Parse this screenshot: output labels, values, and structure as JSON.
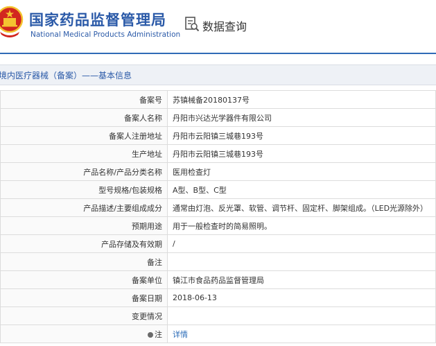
{
  "header": {
    "org_cn": "国家药品监督管理局",
    "org_en": "National Medical Products Administration",
    "query_title": "数据查询"
  },
  "section": {
    "title": "境内医疗器械（备案）——基本信息"
  },
  "rows": [
    {
      "label": "备案号",
      "value": "苏镇械备20180137号"
    },
    {
      "label": "备案人名称",
      "value": "丹阳市兴达光学器件有限公司"
    },
    {
      "label": "备案人注册地址",
      "value": "丹阳市云阳镇三城巷193号"
    },
    {
      "label": "生产地址",
      "value": "丹阳市云阳镇三城巷193号"
    },
    {
      "label": "产品名称/产品分类名称",
      "value": "医用检查灯"
    },
    {
      "label": "型号规格/包装规格",
      "value": "A型、B型、C型"
    },
    {
      "label": "产品描述/主要组成成分",
      "value": "通常由灯泡、反光罩、软管、调节杆、固定杆、脚架组成。（LED光源除外）"
    },
    {
      "label": "预期用途",
      "value": "用于一般检查时的简易照明。"
    },
    {
      "label": "产品存储及有效期",
      "value": "/"
    },
    {
      "label": "备注",
      "value": ""
    },
    {
      "label": "备案单位",
      "value": "镇江市食品药品监督管理局"
    },
    {
      "label": "备案日期",
      "value": "2018-06-13"
    },
    {
      "label": "变更情况",
      "value": ""
    }
  ],
  "note": {
    "label": "注",
    "link": "详情"
  },
  "colors": {
    "brand_blue": "#2b5aa8",
    "link_blue": "#2b6cb8",
    "emblem_red": "#d2261f",
    "emblem_gold": "#f4c430"
  }
}
